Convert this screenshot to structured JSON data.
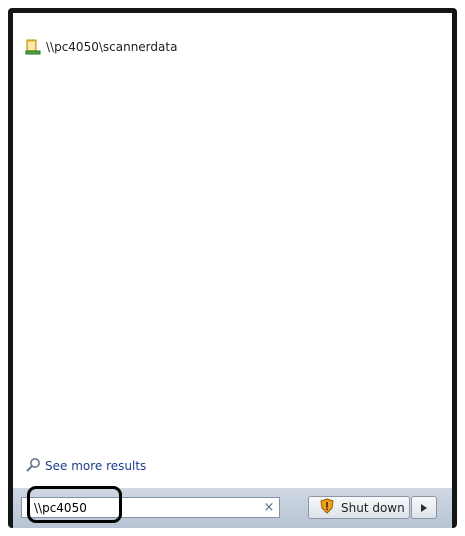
{
  "results": [
    {
      "label": "\\\\pc4050\\scannerdata",
      "icon": "folder-share-icon"
    }
  ],
  "see_more": {
    "label": "See more results",
    "icon": "magnifier-icon"
  },
  "search": {
    "value": "\\\\pc4050",
    "clear_glyph": "×"
  },
  "shutdown": {
    "label": "Shut down",
    "icon": "shield-icon",
    "arrow_icon": "play-arrow-icon"
  },
  "colors": {
    "link": "#1e3c8c",
    "frame": "#151515",
    "bar_top": "#cfd8e3",
    "bar_bottom": "#b8c4d3"
  }
}
